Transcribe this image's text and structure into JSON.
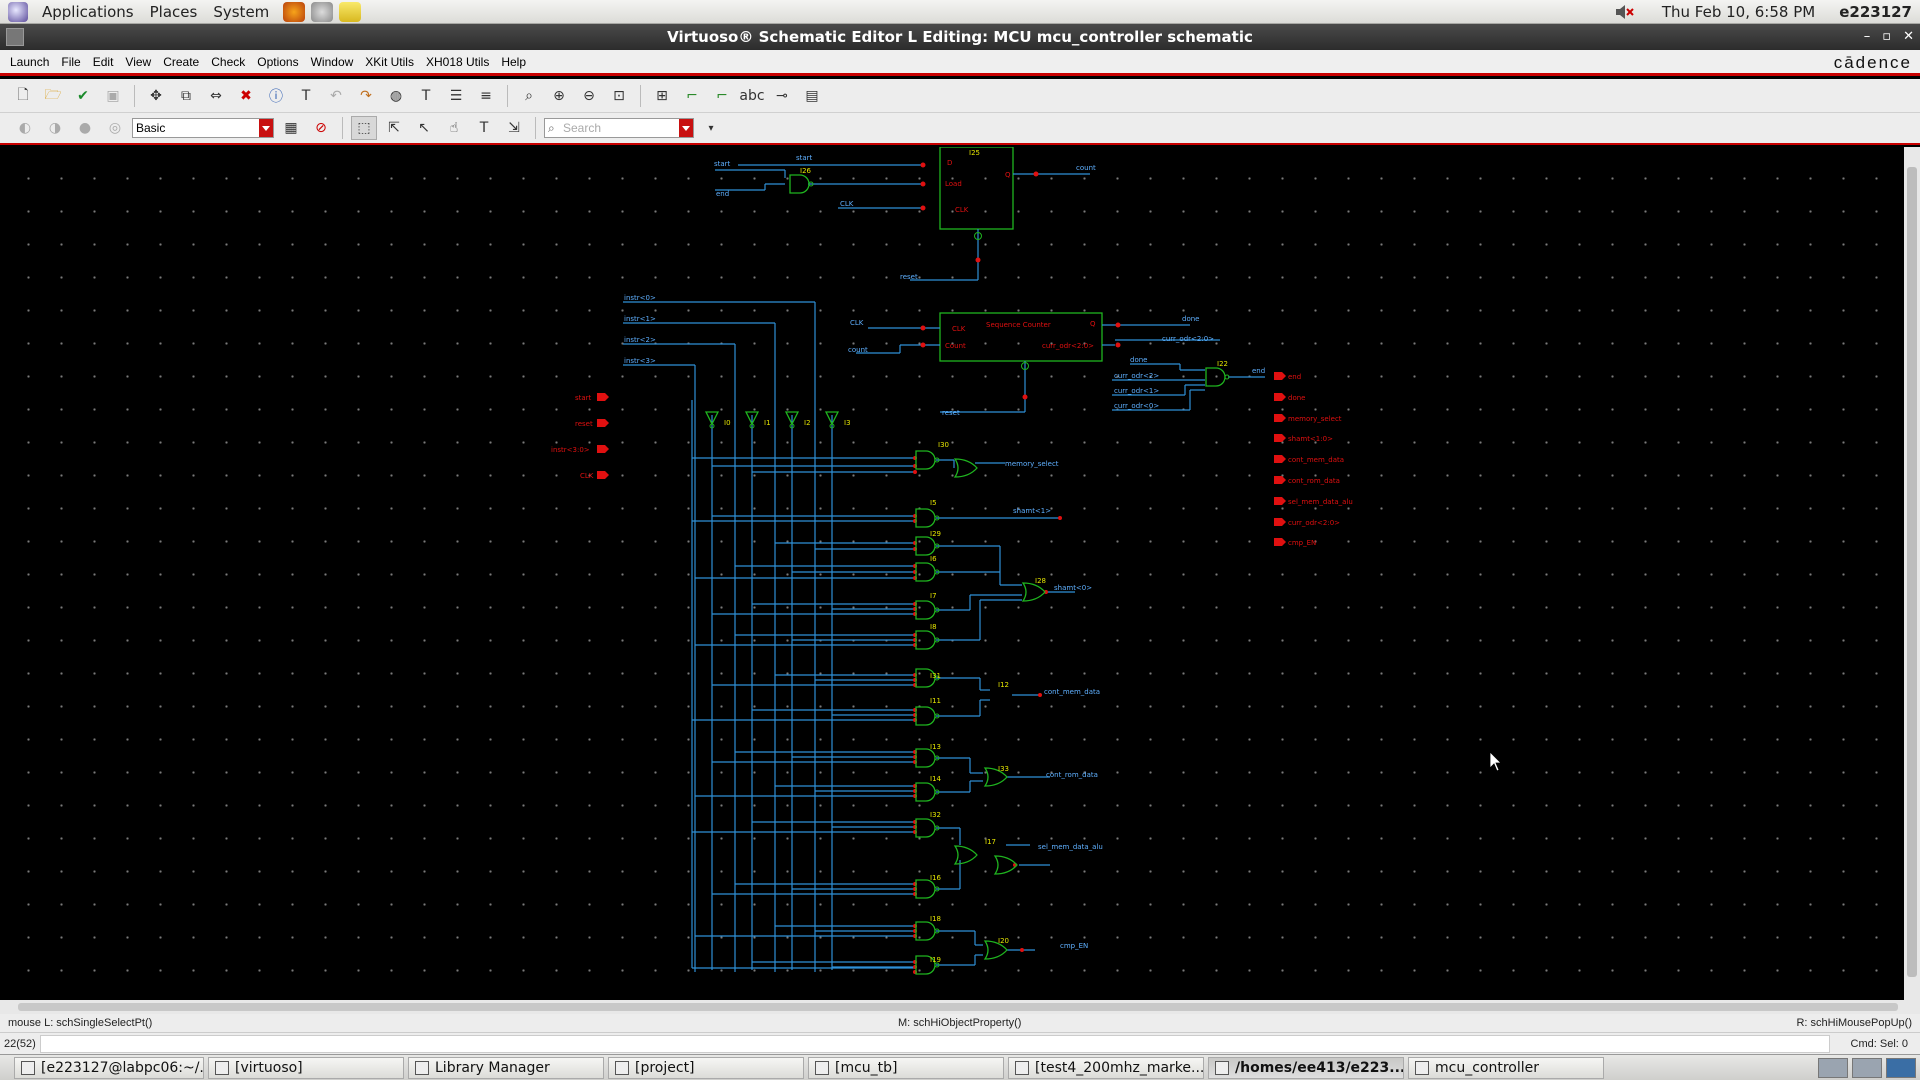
{
  "top_panel": {
    "menus": [
      "Applications",
      "Places",
      "System"
    ],
    "clock": "Thu Feb 10,  6:58 PM",
    "user": "e223127"
  },
  "window": {
    "title": "Virtuoso® Schematic Editor L Editing: MCU mcu_controller schematic",
    "controls": [
      "–",
      "▫",
      "✕"
    ]
  },
  "menubar": {
    "items": [
      "Launch",
      "File",
      "Edit",
      "View",
      "Create",
      "Check",
      "Options",
      "Window",
      "XKit Utils",
      "XH018 Utils",
      "Help"
    ],
    "brand": "cādence"
  },
  "toolbar": {
    "filter_value": "Basic",
    "search_placeholder": "Search"
  },
  "schematic": {
    "upper_block": {
      "instance": "I25",
      "gate_instance": "I26",
      "pins": [
        "D",
        "Load",
        "CLK",
        "Q"
      ],
      "nets": [
        "start",
        "start",
        "end",
        "CLK",
        "reset",
        "count"
      ]
    },
    "sequence_counter": {
      "title": "Sequence Counter",
      "pins_in": [
        "CLK",
        "Count"
      ],
      "pins_out": [
        "Q",
        "curr_odr<2:0>"
      ],
      "nets_in": [
        "CLK",
        "count",
        "reset"
      ],
      "nets_out": [
        "done",
        "curr_odr<2:0>"
      ]
    },
    "and_gate": {
      "instance": "I22",
      "inputs": [
        "done",
        "curr_odr<2>",
        "curr_odr<1>",
        "curr_odr<0>"
      ],
      "output": "end"
    },
    "instr_nets": [
      "instr<0>",
      "instr<1>",
      "instr<2>",
      "instr<3>"
    ],
    "input_pins": [
      "start",
      "reset",
      "instr<3:0>",
      "CLK"
    ],
    "inverters": [
      "I0",
      "I1",
      "I2",
      "I3"
    ],
    "output_pins": [
      "end",
      "done",
      "memory_select",
      "shamt<1:0>",
      "cont_mem_data",
      "cont_rom_data",
      "sel_mem_data_alu",
      "curr_odr<2:0>",
      "cmp_EN"
    ],
    "gates": [
      {
        "inst": "I30",
        "out": "memory_select"
      },
      {
        "inst": "I5",
        "out": "shamt<1>"
      },
      {
        "inst": "I29",
        "out": ""
      },
      {
        "inst": "I6",
        "out": ""
      },
      {
        "inst": "I28",
        "out": "shamt<0>"
      },
      {
        "inst": "I7",
        "out": ""
      },
      {
        "inst": "I8",
        "out": ""
      },
      {
        "inst": "I31",
        "out": ""
      },
      {
        "inst": "I12",
        "out": "cont_mem_data"
      },
      {
        "inst": "I11",
        "out": ""
      },
      {
        "inst": "I13",
        "out": ""
      },
      {
        "inst": "I33",
        "out": "cont_rom_data"
      },
      {
        "inst": "I14",
        "out": ""
      },
      {
        "inst": "I32",
        "out": ""
      },
      {
        "inst": "I17",
        "out": "sel_mem_data_alu"
      },
      {
        "inst": "I16",
        "out": ""
      },
      {
        "inst": "I18",
        "out": ""
      },
      {
        "inst": "I20",
        "out": "cmp_EN"
      },
      {
        "inst": "I19",
        "out": ""
      }
    ]
  },
  "status": {
    "mouse_left": "mouse L: schSingleSelectPt()",
    "mouse_middle": "M: schHiObjectProperty()",
    "mouse_right": "R: schHiMousePopUp()",
    "cmd_count": "22(52)",
    "cmd_sel": "Cmd: Sel: 0"
  },
  "taskbar": {
    "tasks": [
      "[e223127@labpc06:~/...",
      "[virtuoso]",
      "Library Manager",
      "[project]",
      "[mcu_tb]",
      "[test4_200mhz_marke...",
      "/homes/ee413/e223...",
      "mcu_controller"
    ]
  },
  "colors": {
    "wire": "#2f8fd6",
    "instance": "#1fb41f",
    "pin": "#e01010",
    "label_wire": "#5fb0ff",
    "label_inst": "#e6e600"
  }
}
